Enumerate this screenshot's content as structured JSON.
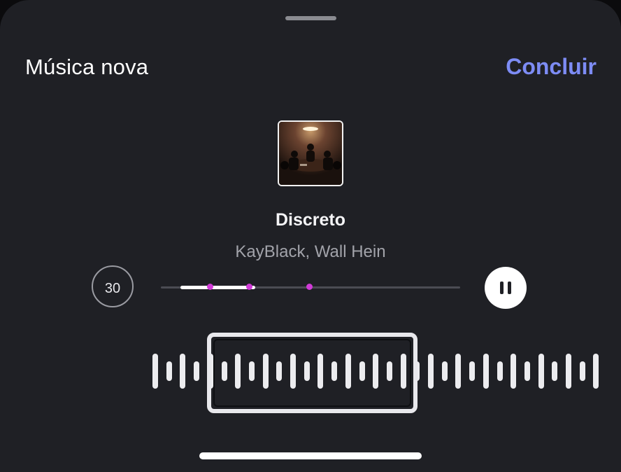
{
  "header": {
    "title": "Música nova",
    "done_label": "Concluir"
  },
  "track": {
    "title": "Discreto",
    "artist": "KayBlack, Wall Hein",
    "cover_icon": "album-cover"
  },
  "playback": {
    "skip_label": "30",
    "progress": 0.25,
    "markers": [
      0.1,
      0.23,
      0.43
    ],
    "state": "playing"
  },
  "colors": {
    "background": "#1f2025",
    "accent": "#7d8cf5",
    "marker": "#d13bd8"
  },
  "waveform": {
    "levels": [
      1,
      0.55,
      1,
      0.55,
      1,
      0.55,
      1,
      0.55,
      1,
      0.55,
      1,
      0.55,
      1,
      0.55,
      1,
      0.55,
      1,
      0.55,
      1,
      0.55,
      1,
      0.55,
      1,
      0.55,
      1,
      0.55,
      1,
      0.55,
      1,
      0.55,
      1,
      0.55,
      1
    ],
    "selection": [
      0.34,
      0.66
    ]
  }
}
